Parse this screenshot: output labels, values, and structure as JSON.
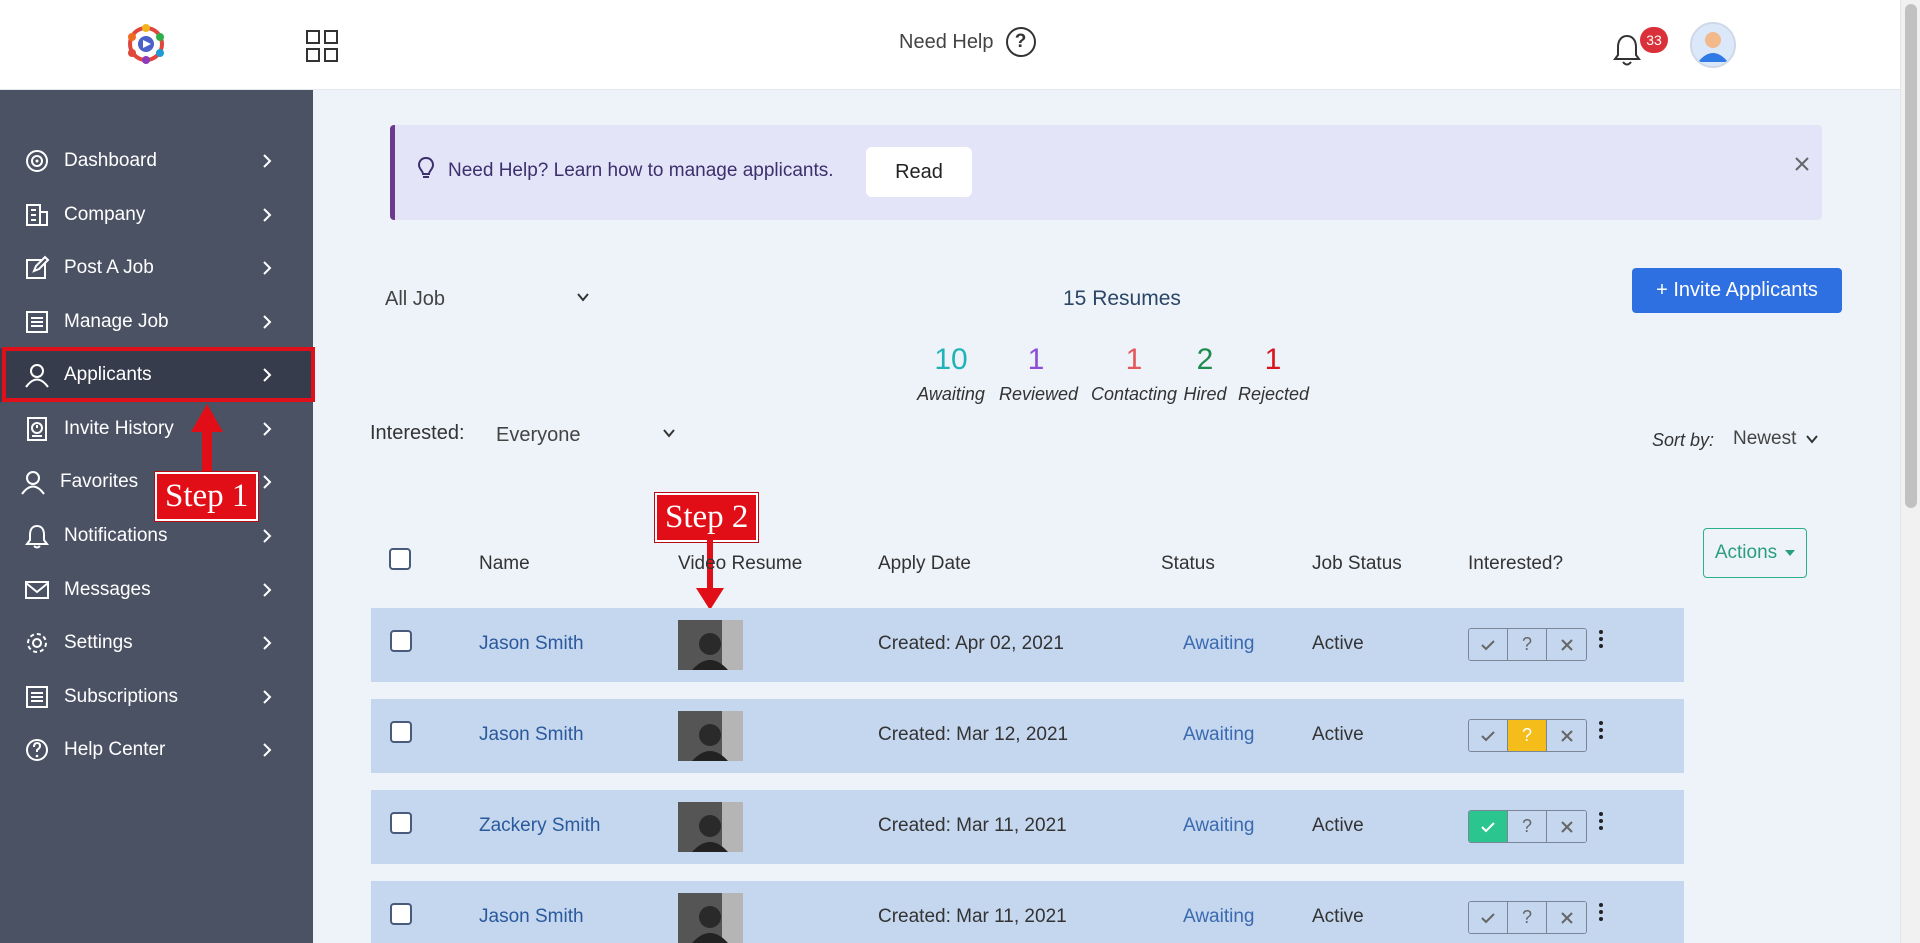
{
  "header": {
    "need_help_label": "Need Help",
    "help_glyph": "?",
    "notification_count": "33"
  },
  "sidebar": {
    "items": [
      {
        "label": "Dashboard",
        "icon": "dashboard-icon"
      },
      {
        "label": "Company",
        "icon": "building-icon"
      },
      {
        "label": "Post A Job",
        "icon": "edit-icon"
      },
      {
        "label": "Manage Job",
        "icon": "list-icon"
      },
      {
        "label": "Applicants",
        "icon": "user-icon"
      },
      {
        "label": "Invite History",
        "icon": "history-icon"
      },
      {
        "label": "Favorites",
        "icon": "user-icon"
      },
      {
        "label": "Notifications",
        "icon": "bell-icon"
      },
      {
        "label": "Messages",
        "icon": "envelope-icon"
      },
      {
        "label": "Settings",
        "icon": "gear-icon"
      },
      {
        "label": "Subscriptions",
        "icon": "list-icon"
      },
      {
        "label": "Help Center",
        "icon": "question-icon"
      }
    ],
    "active": "Applicants"
  },
  "callouts": {
    "step1": "Step 1",
    "step2": "Step 2"
  },
  "banner": {
    "text": "Need Help? Learn how to manage applicants.",
    "read_label": "Read"
  },
  "filters": {
    "job_value": "All Job",
    "resumes_count": "15 Resumes",
    "invite_label": "+ Invite Applicants",
    "interested_label": "Interested:",
    "interested_value": "Everyone",
    "sort_label": "Sort by:",
    "sort_value": "Newest"
  },
  "stats": [
    {
      "value": "10",
      "label": "Awaiting",
      "color": "#1fb3b8"
    },
    {
      "value": "1",
      "label": "Reviewed",
      "color": "#8a4fd6"
    },
    {
      "value": "1",
      "label": "Contacting",
      "color": "#e5585a"
    },
    {
      "value": "2",
      "label": "Hired",
      "color": "#1e8b4f"
    },
    {
      "value": "1",
      "label": "Rejected",
      "color": "#d8141e"
    }
  ],
  "table": {
    "headers": {
      "name": "Name",
      "video": "Video Resume",
      "date": "Apply Date",
      "status": "Status",
      "job_status": "Job Status",
      "interested": "Interested?"
    },
    "actions_label": "Actions",
    "rows": [
      {
        "name": "Jason Smith",
        "date": "Created: Apr 02, 2021",
        "status": "Awaiting",
        "job_status": "Active",
        "interest": "none"
      },
      {
        "name": "Jason Smith",
        "date": "Created: Mar 12, 2021",
        "status": "Awaiting",
        "job_status": "Active",
        "interest": "maybe"
      },
      {
        "name": "Zackery Smith",
        "date": "Created: Mar 11, 2021",
        "status": "Awaiting",
        "job_status": "Active",
        "interest": "yes"
      },
      {
        "name": "Jason Smith",
        "date": "Created: Mar 11, 2021",
        "status": "Awaiting",
        "job_status": "Active",
        "interest": "none"
      }
    ]
  },
  "colors": {
    "sidebar": "#4b5264",
    "primary": "#2e6fe2",
    "callout": "#e10e17"
  }
}
